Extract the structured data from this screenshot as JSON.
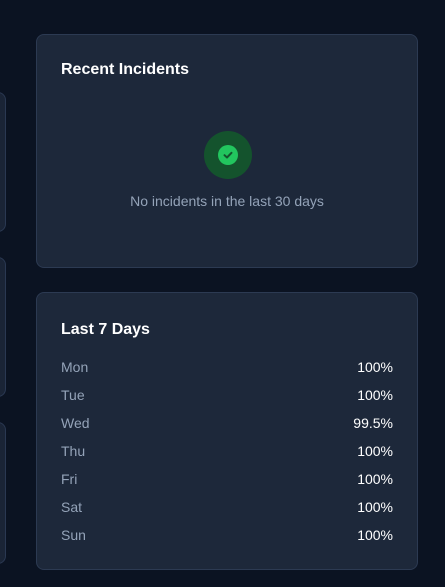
{
  "incidents": {
    "title": "Recent Incidents",
    "empty_message": "No incidents in the last 30 days",
    "status_color": "#22c55e"
  },
  "last7": {
    "title": "Last 7 Days",
    "days": [
      {
        "day": "Mon",
        "value": "100%"
      },
      {
        "day": "Tue",
        "value": "100%"
      },
      {
        "day": "Wed",
        "value": "99.5%"
      },
      {
        "day": "Thu",
        "value": "100%"
      },
      {
        "day": "Fri",
        "value": "100%"
      },
      {
        "day": "Sat",
        "value": "100%"
      },
      {
        "day": "Sun",
        "value": "100%"
      }
    ]
  }
}
